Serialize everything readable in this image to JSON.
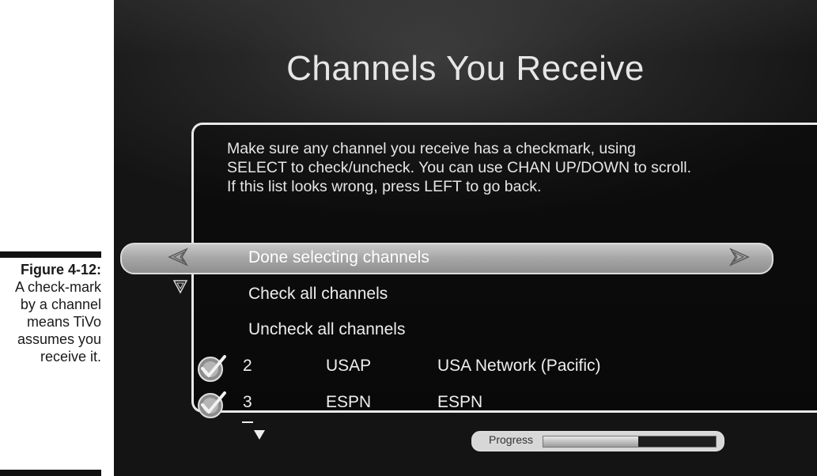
{
  "caption": {
    "figure_label": "Figure 4-12:",
    "figure_text": "A check-mark by a channel means TiVo assumes you receive it."
  },
  "screen": {
    "title": "Channels You Receive",
    "instructions": "Make sure any channel you receive has a checkmark, using SELECT to check/uncheck. You can use CHAN UP/DOWN to scroll. If this list looks wrong, press LEFT to go back.",
    "menu": [
      {
        "label": "Done selecting channels",
        "selected": true
      },
      {
        "label": "Check all channels",
        "selected": false
      },
      {
        "label": "Uncheck all channels",
        "selected": false
      }
    ],
    "channels": [
      {
        "number": "2",
        "callsign": "USAP",
        "name": "USA Network (Pacific)",
        "checked": true
      },
      {
        "number": "3",
        "callsign": "ESPN",
        "name": "ESPN",
        "checked": true
      }
    ],
    "progress": {
      "label": "Progress",
      "fraction": 0.55
    }
  },
  "icons": {
    "left_arrow": "left-arrow-icon",
    "right_arrow": "right-arrow-icon",
    "down_triangle": "down-triangle-icon",
    "check": "checkmark-icon",
    "scroll_down": "scroll-down-icon"
  },
  "colors": {
    "screen_bg": "#1a1a1a",
    "text": "#e6e6e6",
    "highlight": "#a8a8a8"
  }
}
